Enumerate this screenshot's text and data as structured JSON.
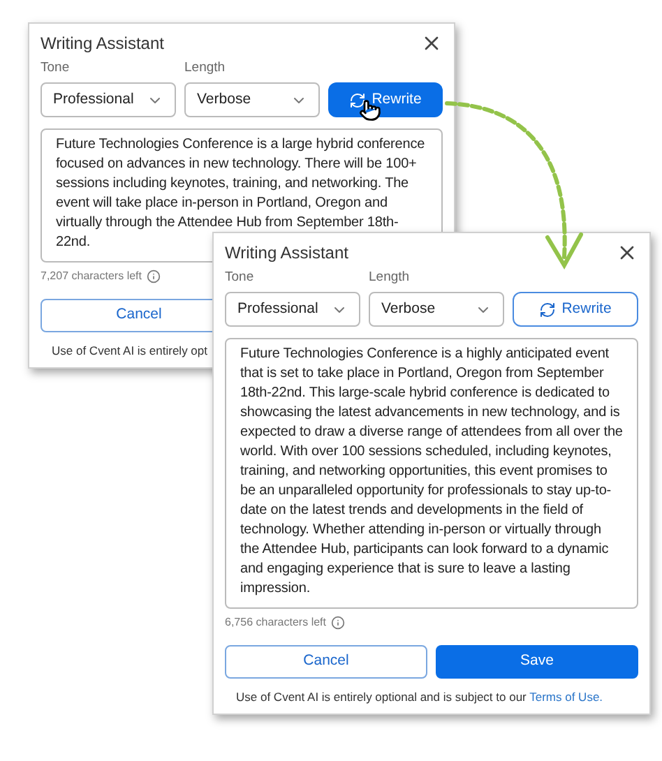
{
  "dialogs": [
    {
      "title": "Writing Assistant",
      "fields": [
        {
          "label": "Tone",
          "value": "Professional"
        },
        {
          "label": "Length",
          "value": "Verbose"
        }
      ],
      "rewrite_button": {
        "label": "Rewrite",
        "primary": true,
        "hovered": true
      },
      "text": "Future Technologies Conference is a large hybrid conference focused on advances in new technology. There will be 100+ sessions including keynotes, training, and networking. The event will take place in-person in Portland, Oregon and virtually through the Attendee Hub from September 18th-22nd.",
      "characters_left": "7,207 characters left",
      "cancel_button": "Cancel",
      "footer": {
        "text": "Use of Cvent AI is entirely opt"
      }
    },
    {
      "title": "Writing Assistant",
      "fields": [
        {
          "label": "Tone",
          "value": "Professional"
        },
        {
          "label": "Length",
          "value": "Verbose"
        }
      ],
      "rewrite_button": {
        "label": "Rewrite",
        "primary": false,
        "hovered": false
      },
      "text": "Future Technologies Conference is a highly anticipated event that is set to take place in Portland, Oregon from September 18th-22nd. This large-scale hybrid conference is dedicated to showcasing the latest advancements in new technology, and is expected to draw a diverse range of attendees from all over the world. With over 100 sessions scheduled, including keynotes, training, and networking opportunities, this event promises to be an unparalleled opportunity for professionals to stay up-to-date on the latest trends and developments in the field of technology. Whether attending in-person or virtually through the Attendee Hub, participants can look forward to a dynamic and engaging experience that is sure to leave a lasting impression.",
      "characters_left": "6,756 characters left",
      "cancel_button": "Cancel",
      "save_button": "Save",
      "footer": {
        "text": "Use of Cvent AI is entirely optional and is subject to our",
        "link": "Terms of Use."
      }
    }
  ]
}
